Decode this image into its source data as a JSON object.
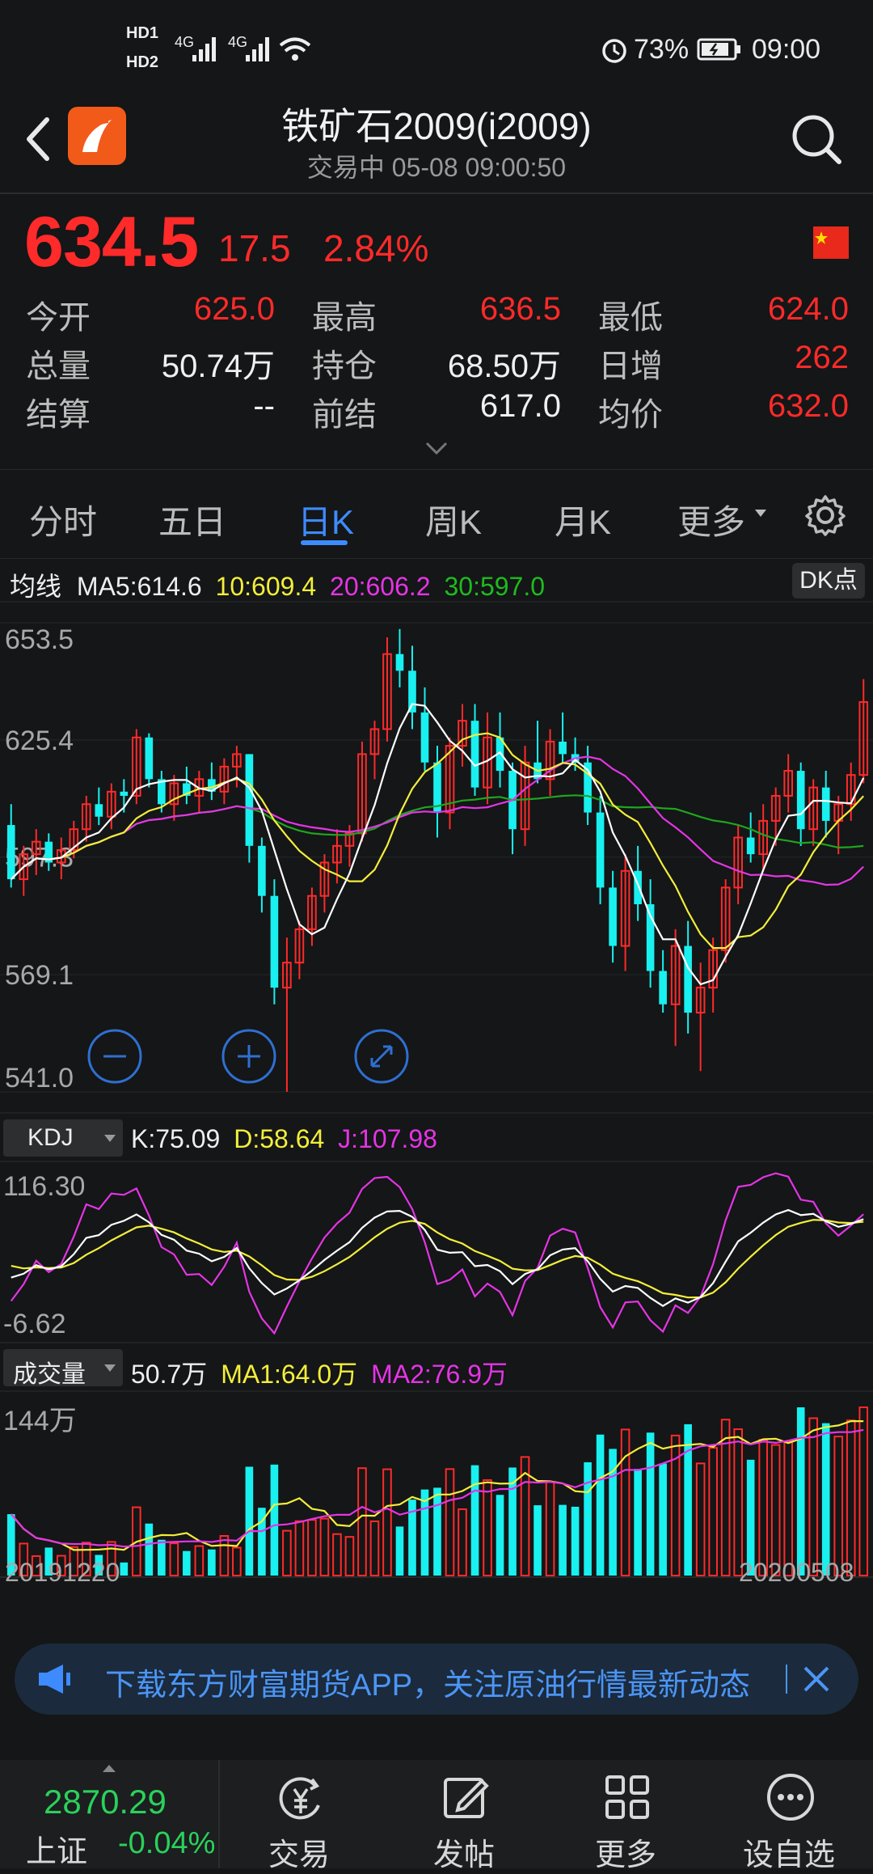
{
  "status": {
    "hd1": "HD1",
    "hd2": "HD2",
    "net1": "4G",
    "net2": "4G",
    "battery": "73%",
    "time": "09:00"
  },
  "header": {
    "title": "铁矿石2009(i2009)",
    "subtitle": "交易中  05-08 09:00:50"
  },
  "quote": {
    "price": "634.5",
    "change": "17.5",
    "change_pct": "2.84%",
    "stats": [
      {
        "label": "今开",
        "value": "625.0",
        "color": "red"
      },
      {
        "label": "最高",
        "value": "636.5",
        "color": "red"
      },
      {
        "label": "最低",
        "value": "624.0",
        "color": "red"
      },
      {
        "label": "总量",
        "value": "50.74万",
        "color": "white"
      },
      {
        "label": "持仓",
        "value": "68.50万",
        "color": "white"
      },
      {
        "label": "日增",
        "value": "262",
        "color": "red"
      },
      {
        "label": "结算",
        "value": "--",
        "color": "white"
      },
      {
        "label": "前结",
        "value": "617.0",
        "color": "white"
      },
      {
        "label": "均价",
        "value": "632.0",
        "color": "red"
      }
    ]
  },
  "tabs": [
    {
      "label": "分时",
      "active": false
    },
    {
      "label": "五日",
      "active": false
    },
    {
      "label": "日K",
      "active": true
    },
    {
      "label": "周K",
      "active": false
    },
    {
      "label": "月K",
      "active": false
    },
    {
      "label": "更多",
      "active": false
    }
  ],
  "ma_legend": {
    "label": "均线",
    "ma5": "MA5:614.6",
    "ma10": "10:609.4",
    "ma20": "20:606.2",
    "ma30": "30:597.0",
    "dk_button": "DK点"
  },
  "colors": {
    "up": "#ff2a2a",
    "down": "#19f0f0",
    "ma5": "#ffffff",
    "ma10": "#f3ee3a",
    "ma20": "#e534e5",
    "ma30": "#1fa51f",
    "accent": "#3d8bff"
  },
  "kline_axis": {
    "ticks": [
      "653.5",
      "625.4",
      "597.3",
      "569.1",
      "541.0"
    ]
  },
  "kdj": {
    "selector": "KDJ",
    "k": "K:75.09",
    "d": "D:58.64",
    "j": "J:107.98",
    "ticks": [
      "116.30",
      "-6.62"
    ]
  },
  "volume": {
    "selector": "成交量",
    "vol": "50.7万",
    "ma1": "MA1:64.0万",
    "ma2": "MA2:76.9万",
    "tick": "144万"
  },
  "dates": {
    "start": "20191220",
    "end": "20200508"
  },
  "banner": {
    "text": "下载东方财富期货APP，关注原油行情最新动态"
  },
  "index": {
    "value": "2870.29",
    "name": "上证",
    "pct": "-0.04%"
  },
  "nav": [
    {
      "label": "交易",
      "icon": "yen-trade-icon"
    },
    {
      "label": "发帖",
      "icon": "edit-post-icon"
    },
    {
      "label": "更多",
      "icon": "grid-more-icon"
    },
    {
      "label": "设自选",
      "icon": "more-dots-icon"
    }
  ],
  "chart_data": {
    "type": "candlestick",
    "price_range": [
      541.0,
      653.5
    ],
    "candles": [
      {
        "o": 605,
        "h": 610,
        "l": 590,
        "c": 592
      },
      {
        "o": 592,
        "h": 600,
        "l": 588,
        "c": 598
      },
      {
        "o": 598,
        "h": 604,
        "l": 593,
        "c": 601
      },
      {
        "o": 601,
        "h": 603,
        "l": 594,
        "c": 596
      },
      {
        "o": 596,
        "h": 602,
        "l": 592,
        "c": 599
      },
      {
        "o": 599,
        "h": 606,
        "l": 597,
        "c": 604
      },
      {
        "o": 604,
        "h": 612,
        "l": 601,
        "c": 610
      },
      {
        "o": 610,
        "h": 614,
        "l": 605,
        "c": 607
      },
      {
        "o": 607,
        "h": 615,
        "l": 604,
        "c": 613
      },
      {
        "o": 613,
        "h": 616,
        "l": 608,
        "c": 612
      },
      {
        "o": 612,
        "h": 628,
        "l": 610,
        "c": 626
      },
      {
        "o": 626,
        "h": 627,
        "l": 614,
        "c": 616
      },
      {
        "o": 616,
        "h": 618,
        "l": 608,
        "c": 610
      },
      {
        "o": 610,
        "h": 617,
        "l": 606,
        "c": 615
      },
      {
        "o": 615,
        "h": 619,
        "l": 610,
        "c": 612
      },
      {
        "o": 612,
        "h": 618,
        "l": 608,
        "c": 616
      },
      {
        "o": 616,
        "h": 620,
        "l": 611,
        "c": 613
      },
      {
        "o": 613,
        "h": 621,
        "l": 610,
        "c": 619
      },
      {
        "o": 619,
        "h": 624,
        "l": 614,
        "c": 622
      },
      {
        "o": 622,
        "h": 622,
        "l": 596,
        "c": 600
      },
      {
        "o": 600,
        "h": 602,
        "l": 584,
        "c": 588
      },
      {
        "o": 588,
        "h": 592,
        "l": 562,
        "c": 566
      },
      {
        "o": 566,
        "h": 578,
        "l": 541,
        "c": 572
      },
      {
        "o": 572,
        "h": 582,
        "l": 568,
        "c": 580
      },
      {
        "o": 580,
        "h": 590,
        "l": 576,
        "c": 588
      },
      {
        "o": 588,
        "h": 598,
        "l": 584,
        "c": 596
      },
      {
        "o": 596,
        "h": 604,
        "l": 591,
        "c": 600
      },
      {
        "o": 600,
        "h": 605,
        "l": 595,
        "c": 603
      },
      {
        "o": 603,
        "h": 625,
        "l": 601,
        "c": 622
      },
      {
        "o": 622,
        "h": 630,
        "l": 616,
        "c": 628
      },
      {
        "o": 628,
        "h": 650,
        "l": 625,
        "c": 646
      },
      {
        "o": 646,
        "h": 652,
        "l": 638,
        "c": 642
      },
      {
        "o": 642,
        "h": 648,
        "l": 628,
        "c": 632
      },
      {
        "o": 632,
        "h": 638,
        "l": 618,
        "c": 620
      },
      {
        "o": 620,
        "h": 624,
        "l": 602,
        "c": 608
      },
      {
        "o": 608,
        "h": 626,
        "l": 604,
        "c": 624
      },
      {
        "o": 624,
        "h": 634,
        "l": 619,
        "c": 630
      },
      {
        "o": 630,
        "h": 634,
        "l": 612,
        "c": 614
      },
      {
        "o": 614,
        "h": 632,
        "l": 610,
        "c": 626
      },
      {
        "o": 626,
        "h": 632,
        "l": 614,
        "c": 618
      },
      {
        "o": 618,
        "h": 620,
        "l": 598,
        "c": 604
      },
      {
        "o": 604,
        "h": 624,
        "l": 600,
        "c": 620
      },
      {
        "o": 620,
        "h": 630,
        "l": 615,
        "c": 616
      },
      {
        "o": 616,
        "h": 628,
        "l": 612,
        "c": 625
      },
      {
        "o": 625,
        "h": 632,
        "l": 620,
        "c": 622
      },
      {
        "o": 622,
        "h": 626,
        "l": 618,
        "c": 620
      },
      {
        "o": 620,
        "h": 624,
        "l": 605,
        "c": 608
      },
      {
        "o": 608,
        "h": 612,
        "l": 586,
        "c": 590
      },
      {
        "o": 590,
        "h": 594,
        "l": 572,
        "c": 576
      },
      {
        "o": 576,
        "h": 598,
        "l": 570,
        "c": 594
      },
      {
        "o": 594,
        "h": 600,
        "l": 582,
        "c": 586
      },
      {
        "o": 586,
        "h": 592,
        "l": 566,
        "c": 570
      },
      {
        "o": 570,
        "h": 575,
        "l": 560,
        "c": 562
      },
      {
        "o": 562,
        "h": 580,
        "l": 552,
        "c": 576
      },
      {
        "o": 576,
        "h": 582,
        "l": 555,
        "c": 560
      },
      {
        "o": 560,
        "h": 572,
        "l": 546,
        "c": 566
      },
      {
        "o": 566,
        "h": 578,
        "l": 560,
        "c": 575
      },
      {
        "o": 575,
        "h": 592,
        "l": 572,
        "c": 590
      },
      {
        "o": 590,
        "h": 605,
        "l": 586,
        "c": 602
      },
      {
        "o": 602,
        "h": 608,
        "l": 596,
        "c": 598
      },
      {
        "o": 598,
        "h": 610,
        "l": 594,
        "c": 606
      },
      {
        "o": 606,
        "h": 614,
        "l": 600,
        "c": 612
      },
      {
        "o": 612,
        "h": 622,
        "l": 608,
        "c": 618
      },
      {
        "o": 618,
        "h": 620,
        "l": 600,
        "c": 604
      },
      {
        "o": 604,
        "h": 616,
        "l": 600,
        "c": 614
      },
      {
        "o": 614,
        "h": 618,
        "l": 602,
        "c": 606
      },
      {
        "o": 606,
        "h": 612,
        "l": 598,
        "c": 610
      },
      {
        "o": 610,
        "h": 620,
        "l": 606,
        "c": 617
      },
      {
        "o": 617,
        "h": 640,
        "l": 615,
        "c": 634.5
      }
    ]
  }
}
